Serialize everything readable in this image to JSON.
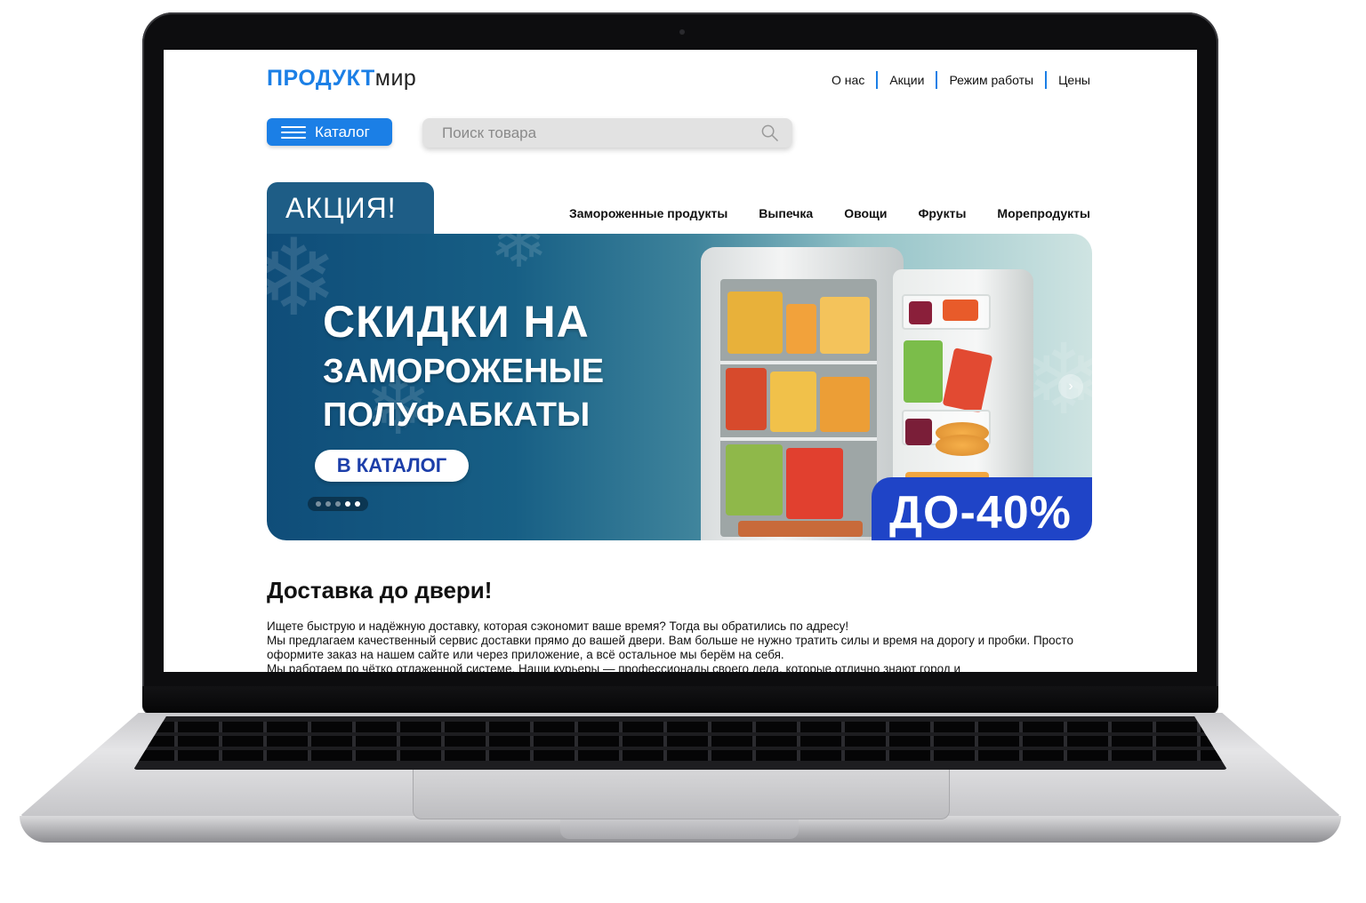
{
  "header": {
    "logo_strong": "ПРОДУКТ",
    "logo_light": "мир",
    "nav": [
      "О нас",
      "Акции",
      "Режим работы",
      "Цены"
    ]
  },
  "toolbar": {
    "catalog_label": "Каталог",
    "search_placeholder": "Поиск товара"
  },
  "promo": {
    "tab_label": "АКЦИЯ!",
    "categories": [
      "Замороженные продукты",
      "Выпечка",
      "Овощи",
      "Фрукты",
      "Морепродукты"
    ],
    "title_line1": "СКИДКИ НА",
    "title_line2": "ЗАМОРОЖЕНЫЕ",
    "title_line3": "ПОЛУФАБКАТЫ",
    "cta_label": "В КАТАЛОГ",
    "discount_badge": "ДО-40%",
    "slides_total": 5,
    "active_slides": [
      4,
      5
    ]
  },
  "delivery": {
    "title": "Доставка до двери!",
    "paragraphs": [
      "Ищете быструю и надёжную доставку, которая сэкономит ваше время? Тогда вы обратились по адресу!",
      "Мы предлагаем качественный сервис доставки прямо до вашей двери. Вам больше не нужно тратить силы и время на дорогу и пробки. Просто оформите заказ на нашем сайте или через приложение, а всё остальное мы берём на себя.",
      "Мы работаем по чётко отлаженной системе. Наши курьеры — профессионалы своего дела, которые отлично знают город и"
    ]
  },
  "colors": {
    "accent": "#1b7fe6",
    "promo_tab": "#1e5d86",
    "badge": "#1f44c7",
    "cta_text": "#1c3ea9"
  },
  "icons": [
    "hamburger-icon",
    "search-icon",
    "chevron-right-icon",
    "snowflake-icon"
  ]
}
